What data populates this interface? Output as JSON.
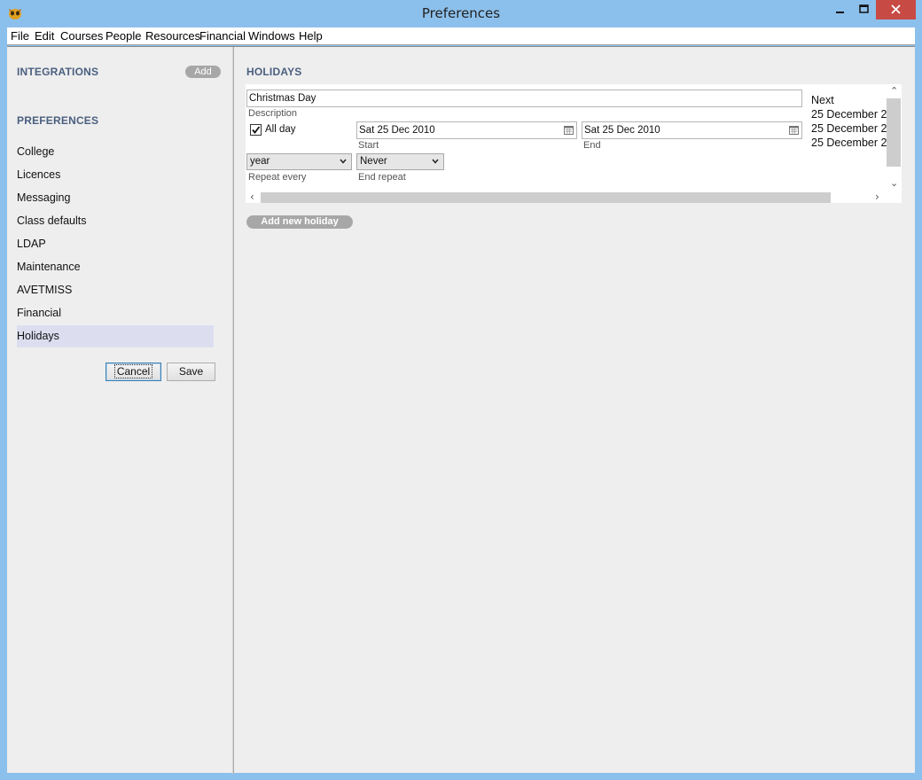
{
  "window": {
    "title": "Preferences"
  },
  "menu": [
    "File",
    "Edit",
    "Courses",
    "People",
    "Resources",
    "Financial",
    "Windows",
    "Help"
  ],
  "sidebar": {
    "integrations_heading": "INTEGRATIONS",
    "add_label": "Add",
    "preferences_heading": "PREFERENCES",
    "items": [
      {
        "label": "College"
      },
      {
        "label": "Licences"
      },
      {
        "label": "Messaging"
      },
      {
        "label": "Class defaults"
      },
      {
        "label": "LDAP"
      },
      {
        "label": "Maintenance"
      },
      {
        "label": "AVETMISS"
      },
      {
        "label": "Financial"
      },
      {
        "label": "Holidays",
        "selected": true
      }
    ],
    "cancel_label": "Cancel",
    "save_label": "Save"
  },
  "holidays": {
    "heading": "HOLIDAYS",
    "description_value": "Christmas Day",
    "description_label": "Description",
    "all_day_label": "All day",
    "all_day_checked": true,
    "start_value": "Sat 25 Dec 2010",
    "start_label": "Start",
    "end_value": "Sat 25 Dec 2010",
    "end_label": "End",
    "repeat_value": "year",
    "repeat_label": "Repeat every",
    "end_repeat_value": "Never",
    "end_repeat_label": "End repeat",
    "next_heading": "Next",
    "next_dates": [
      "25 December 2",
      "25 December 2",
      "25 December 2"
    ],
    "add_new_label": "Add new holiday"
  },
  "colors": {
    "titlebar": "#8cc0ec",
    "close": "#c74a45",
    "heading": "#4a5f7f",
    "selected": "#dcdef0",
    "pill": "#a7a7a7"
  }
}
